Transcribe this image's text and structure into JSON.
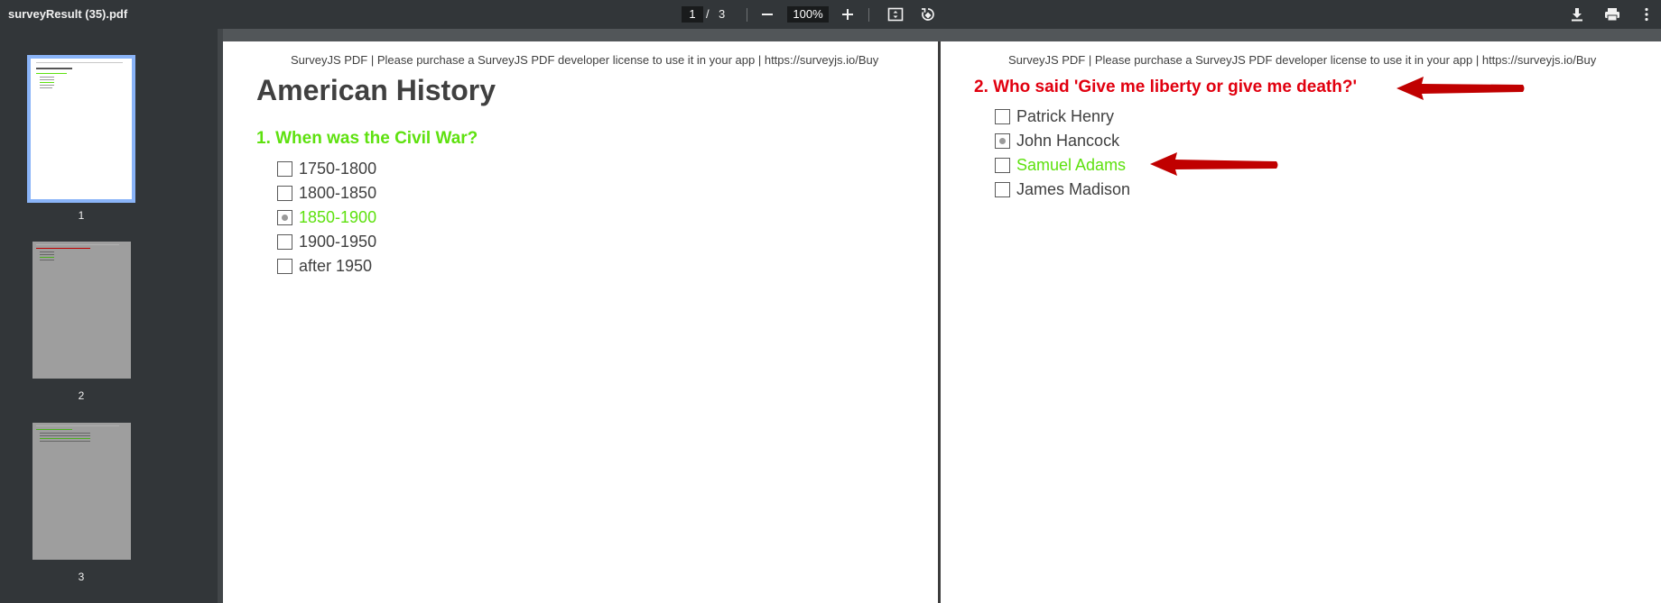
{
  "toolbar": {
    "file_title": "surveyResult (35).pdf",
    "current_page": "1",
    "page_separator": "/",
    "total_pages": "3",
    "zoom": "100%",
    "icons": [
      "minus-icon",
      "plus-icon",
      "fit-page-icon",
      "rotate-icon",
      "download-icon",
      "print-icon",
      "more-vert-icon"
    ]
  },
  "thumbnails": [
    {
      "number": "1"
    },
    {
      "number": "2"
    },
    {
      "number": "3"
    }
  ],
  "page1": {
    "banner": "SurveyJS PDF | Please purchase a SurveyJS PDF developer license to use it in your app | https://surveyjs.io/Buy",
    "title": "American History",
    "question": "1. When was the Civil War?",
    "options": [
      {
        "label": "1750-1800",
        "selected": false,
        "correct": false
      },
      {
        "label": "1800-1850",
        "selected": false,
        "correct": false
      },
      {
        "label": "1850-1900",
        "selected": true,
        "correct": true
      },
      {
        "label": "1900-1950",
        "selected": false,
        "correct": false
      },
      {
        "label": "after 1950",
        "selected": false,
        "correct": false
      }
    ]
  },
  "page2": {
    "banner": "SurveyJS PDF | Please purchase a SurveyJS PDF developer license to use it in your app | https://surveyjs.io/Buy",
    "question": "2. Who said 'Give me liberty or give me death?'",
    "options": [
      {
        "label": "Patrick Henry",
        "selected": false,
        "correct": false
      },
      {
        "label": "John Hancock",
        "selected": true,
        "correct": false
      },
      {
        "label": "Samuel Adams",
        "selected": false,
        "correct": true
      },
      {
        "label": "James Madison",
        "selected": false,
        "correct": false
      }
    ]
  },
  "colors": {
    "correct": "#5ee10f",
    "incorrect_question": "#e1000f",
    "arrow": "#c00000",
    "toolbar": "#323639",
    "viewer_bg": "#525659"
  }
}
